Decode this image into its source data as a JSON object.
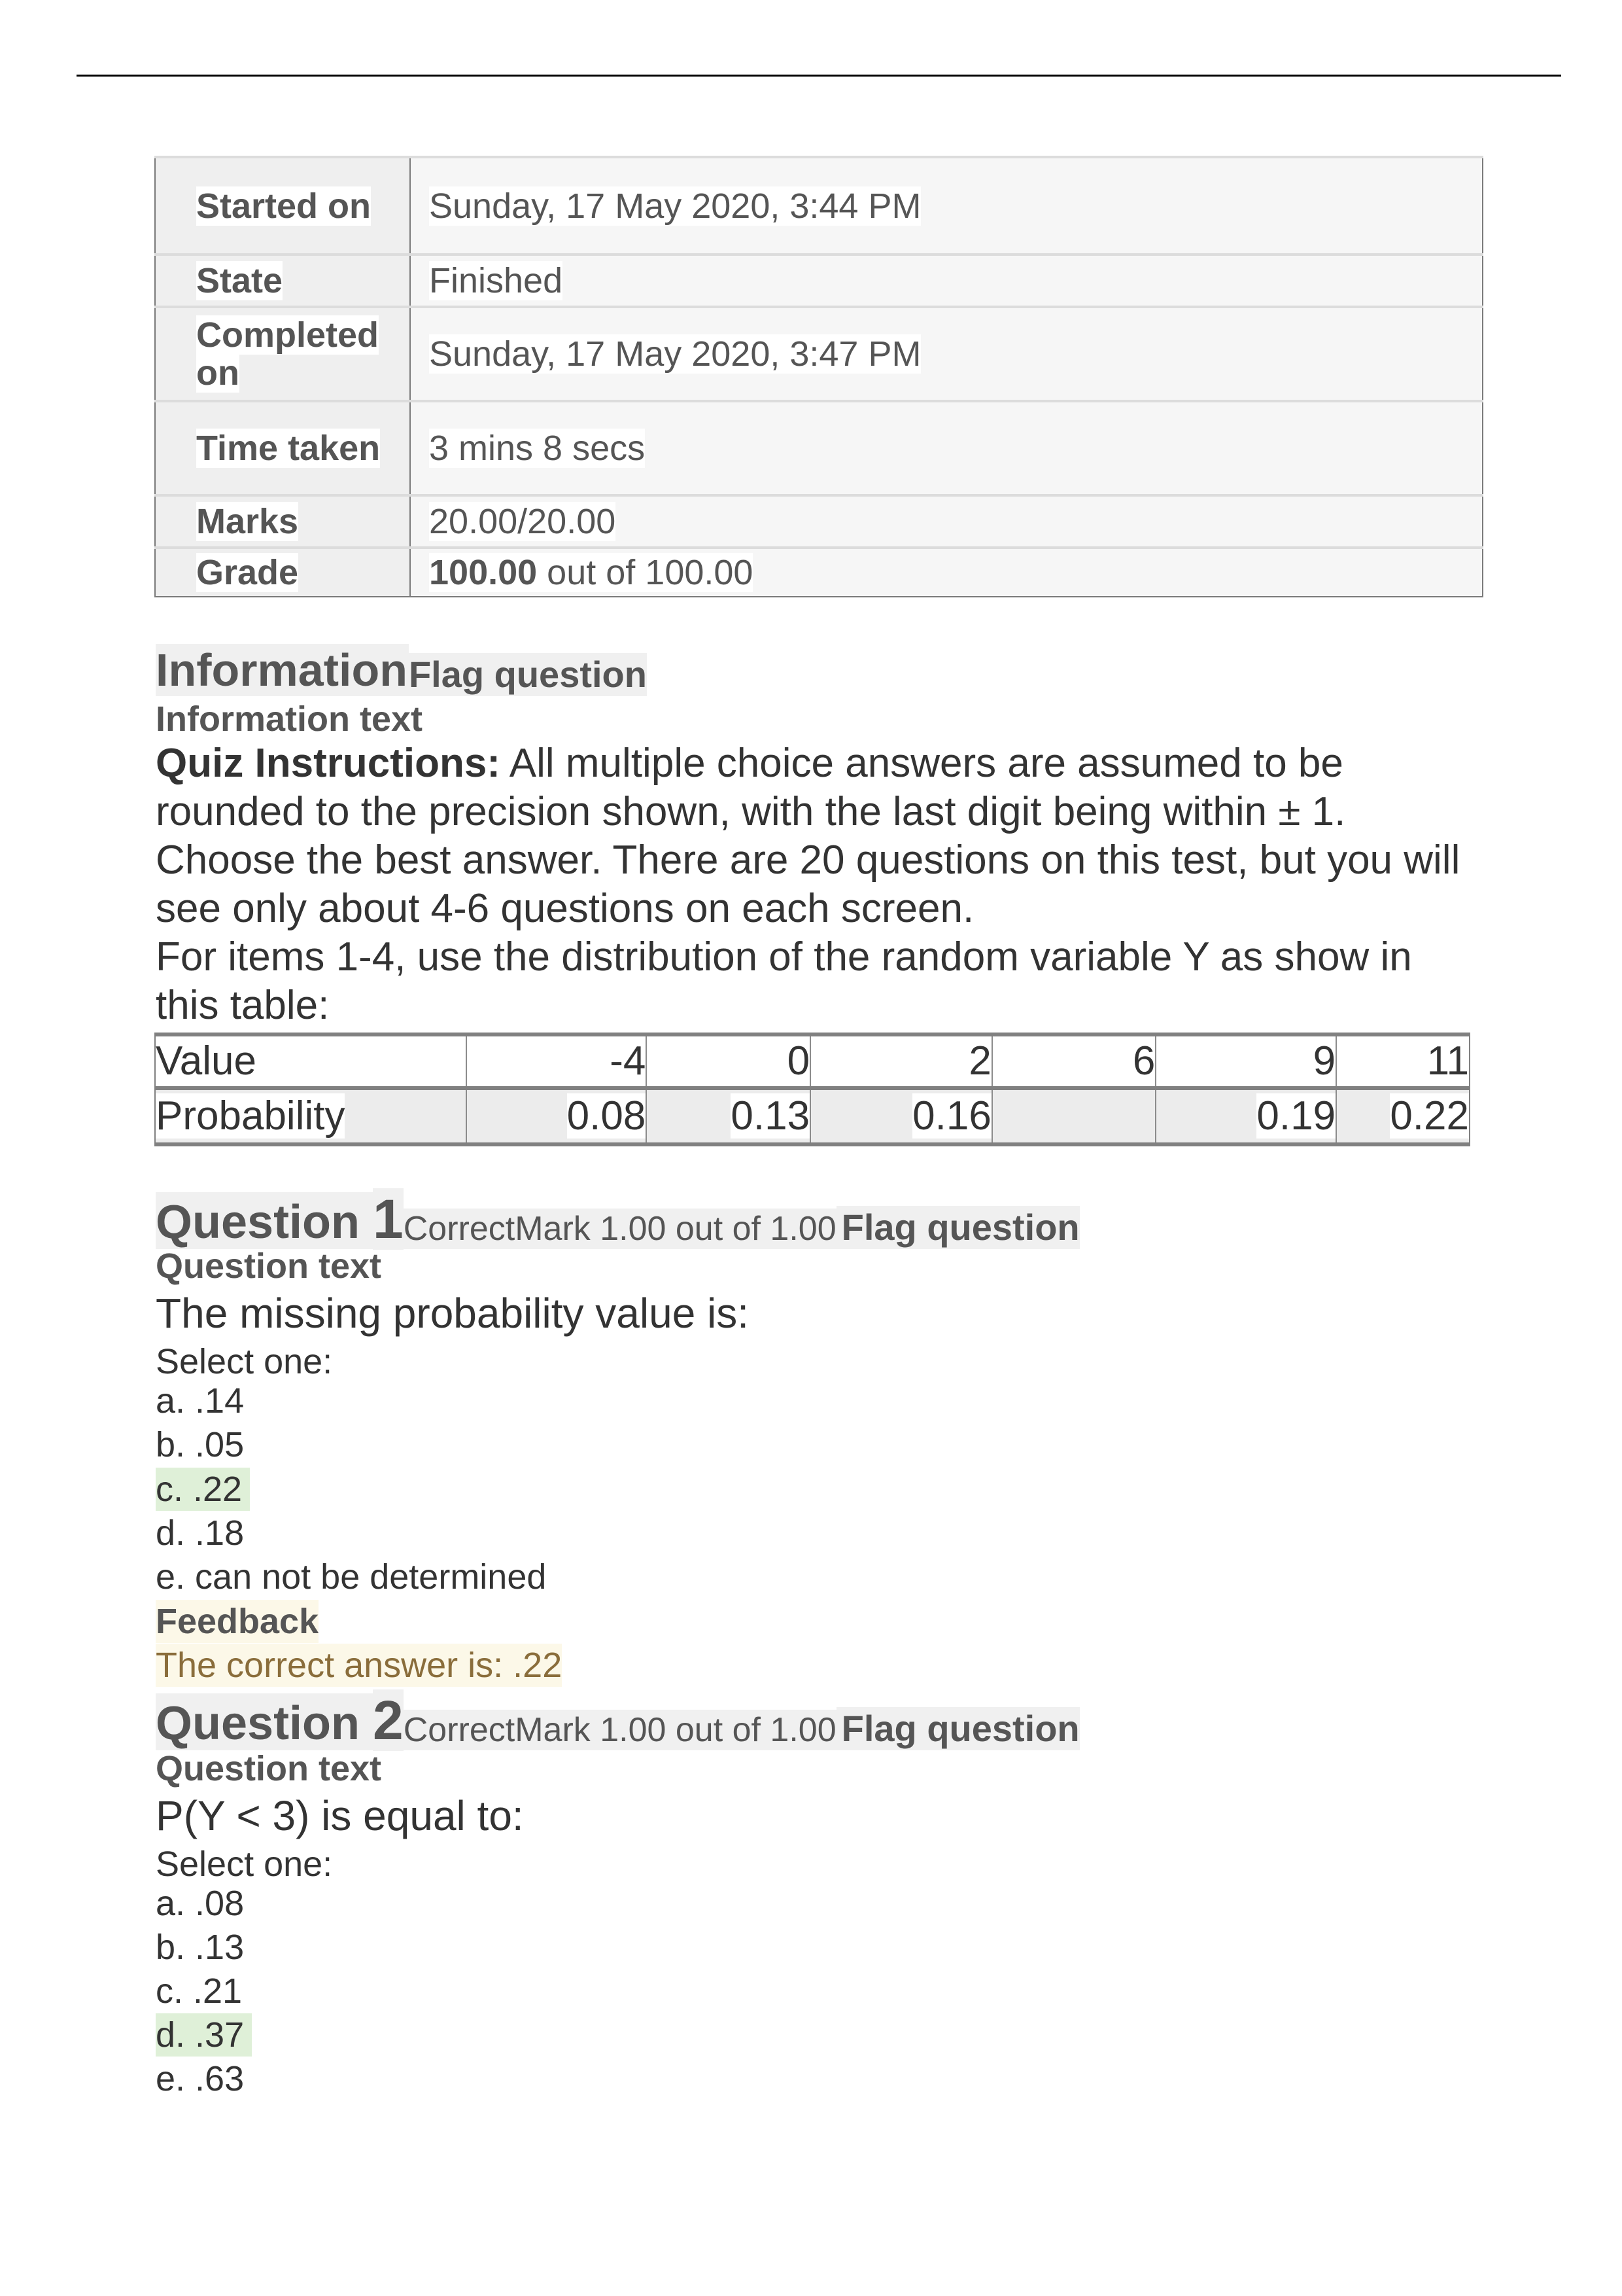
{
  "summary": {
    "rows": [
      {
        "label": "Started on",
        "value": "Sunday, 17 May 2020, 3:44 PM"
      },
      {
        "label": "State",
        "value": "Finished"
      },
      {
        "label": "Completed on",
        "value": "Sunday, 17 May 2020, 3:47 PM"
      },
      {
        "label": "Time taken",
        "value": "3 mins 8 secs"
      },
      {
        "label": "Marks",
        "value": "20.00/20.00"
      },
      {
        "label": "Grade",
        "value_bold": "100.00",
        "value_rest": " out of 100.00"
      }
    ]
  },
  "information": {
    "title": "Information",
    "flag_label": "Flag question",
    "subtitle": "Information text",
    "instructions_label": "Quiz Instructions:",
    "instructions_text": " All multiple choice answers are assumed to be rounded to the precision shown, with the last digit being within ± 1. Choose the best answer. There are 20 questions on this test, but you will see only about 4-6 questions on each screen.",
    "items_text": "For items 1-4, use the distribution of the random variable Y as show in this table:"
  },
  "distribution_table": {
    "row_labels": [
      "Value",
      "Probability"
    ],
    "values": [
      "-4",
      "0",
      "2",
      "6",
      "9",
      "11"
    ],
    "probabilities": [
      "0.08",
      "0.13",
      "0.16",
      "",
      "0.19",
      "0.22"
    ]
  },
  "questions": [
    {
      "title": "Question ",
      "number": "1",
      "status": "Correct",
      "mark": "Mark 1.00 out of 1.00",
      "flag_label": "Flag question",
      "subtitle": "Question text",
      "text": "The missing probability value is:",
      "select_label": "Select one:",
      "options": [
        "a. .14",
        "b. .05",
        "c. .22",
        "d. .18",
        "e. can not be determined"
      ],
      "correct_index": 2,
      "feedback_title": "Feedback",
      "feedback_text": "The correct answer is: .22"
    },
    {
      "title": "Question ",
      "number": "2",
      "status": "Correct",
      "mark": "Mark 1.00 out of 1.00",
      "flag_label": "Flag question",
      "subtitle": "Question text",
      "text": "P(Y < 3) is equal to:",
      "select_label": "Select one:",
      "options": [
        "a. .08",
        "b. .13",
        "c. .21",
        "d. .37",
        "e. .63"
      ],
      "correct_index": 3
    }
  ],
  "colors": {
    "correct_highlight": "#dff0d8",
    "feedback_background": "#fcf8e8",
    "feedback_text": "#8a6d3b"
  }
}
